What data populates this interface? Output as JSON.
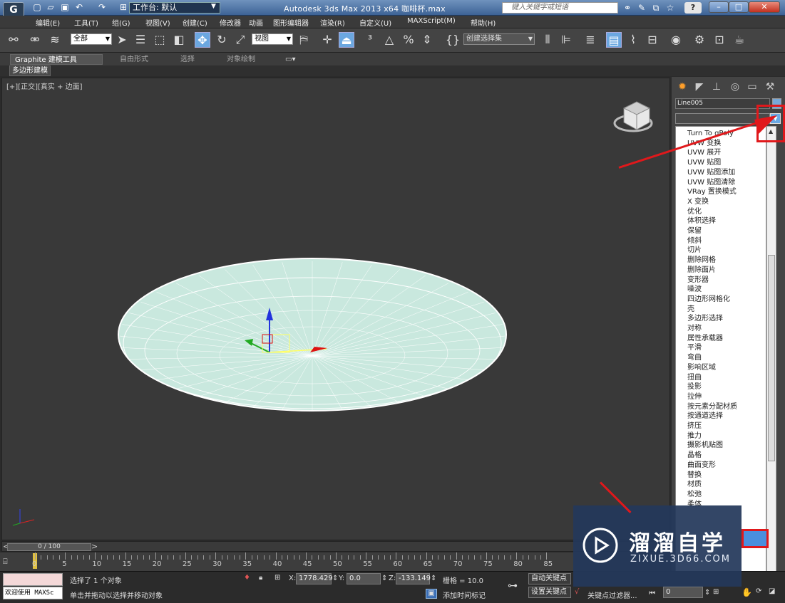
{
  "titlebar": {
    "app_logo": "G",
    "workspace_label": "工作台: 默认",
    "title": "Autodesk 3ds Max  2013 x64     咖啡杯.max",
    "search_placeholder": "键入关键字或短语",
    "help": "?"
  },
  "menu": [
    "编辑(E)",
    "工具(T)",
    "组(G)",
    "视图(V)",
    "创建(C)",
    "修改器",
    "动画",
    "图形编辑器",
    "渲染(R)",
    "自定义(U)",
    "MAXScript(M)",
    "帮助(H)"
  ],
  "toolbar": {
    "selection_filter": "全部",
    "ref_coord": "视图",
    "selection_set": "创建选择集"
  },
  "ribbon": {
    "tabs": [
      "Graphite 建模工具",
      "自由形式",
      "选择",
      "对象绘制"
    ],
    "sub_label": "多边形建模"
  },
  "viewport": {
    "label": "[+][正交][真实 + 边面]"
  },
  "command_panel": {
    "object_name": "Line005",
    "modifier_list_items": [
      "Turn To gPoly",
      "UVW 变换",
      "UVW 展开",
      "UVW 贴图",
      "UVW 贴图添加",
      "UVW 贴图清除",
      "VRay 置换模式",
      "X 变换",
      "优化",
      "体积选择",
      "保留",
      "倾斜",
      "切片",
      "删除网格",
      "删除面片",
      "变形器",
      "噪波",
      "四边形网格化",
      "壳",
      "多边形选择",
      "对称",
      "属性承载器",
      "平滑",
      "弯曲",
      "影响区域",
      "扭曲",
      "投影",
      "拉伸",
      "按元素分配材质",
      "按通道选择",
      "挤压",
      "推力",
      "摄影机贴图",
      "晶格",
      "曲面变形",
      "替换",
      "材质",
      "松弛",
      "柔体"
    ]
  },
  "timeline": {
    "slider": "0 / 100",
    "ticks": [
      "0",
      "5",
      "10",
      "15",
      "20",
      "25",
      "30",
      "35",
      "40",
      "45",
      "50",
      "55",
      "60",
      "65",
      "70",
      "75",
      "80",
      "85"
    ]
  },
  "status": {
    "maxscript_label": "欢迎使用 MAXSc",
    "selected": "选择了 1 个对象",
    "prompt": "单击并拖动以选择并移动对象",
    "x_label": "X:",
    "x_value": "1778.429",
    "y_label": "Y:",
    "y_value": "0.0",
    "z_label": "Z:",
    "z_value": "-133.149",
    "grid": "栅格 = 10.0",
    "auto_key": "自动关键点",
    "set_key": "设置关键点",
    "key_filter": "关键点过滤器...",
    "add_time_tag": "添加时间标记",
    "frame": "0"
  },
  "watermark": {
    "brand": "溜溜自学",
    "url": "ZIXUE.3D66.COM"
  },
  "colors": {
    "mesh_fill": "#cde9e0",
    "mesh_wire": "#ffffff",
    "annotation": "#e0181b"
  }
}
